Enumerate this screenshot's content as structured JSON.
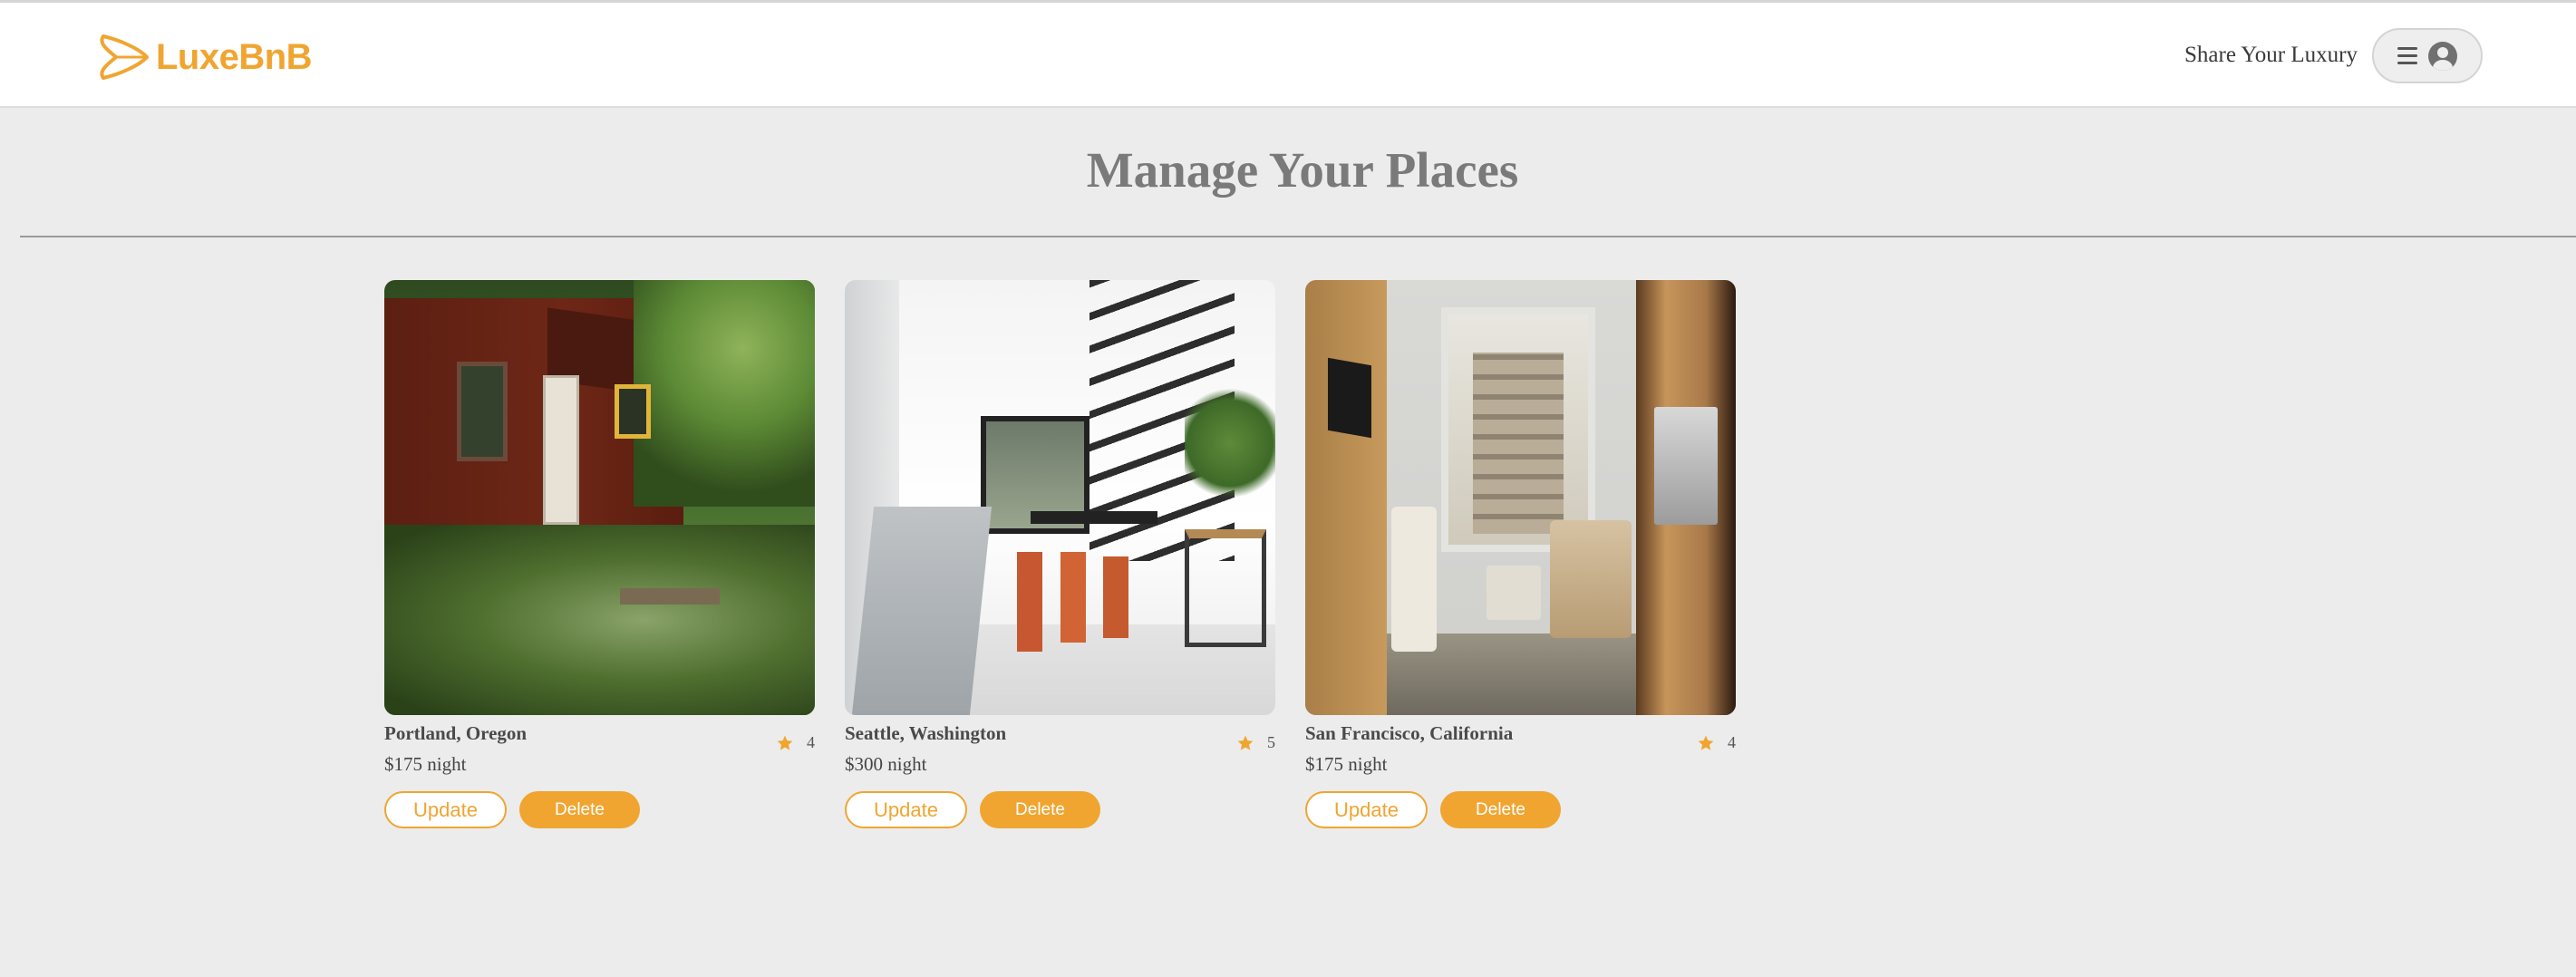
{
  "app": {
    "brand": "LuxeBnB",
    "brand_color": "#f0a531"
  },
  "header": {
    "share_link": "Share Your Luxury",
    "menu_icon": "hamburger-icon",
    "user_icon": "user-circle-icon"
  },
  "page": {
    "title": "Manage Your Places"
  },
  "places": [
    {
      "location": "Portland, Oregon",
      "price": "$175 night",
      "rating": "4",
      "update_label": "Update",
      "delete_label": "Delete"
    },
    {
      "location": "Seattle, Washington",
      "price": "$300 night",
      "rating": "5",
      "update_label": "Update",
      "delete_label": "Delete"
    },
    {
      "location": "San Francisco, California",
      "price": "$175 night",
      "rating": "4",
      "update_label": "Update",
      "delete_label": "Delete"
    }
  ]
}
